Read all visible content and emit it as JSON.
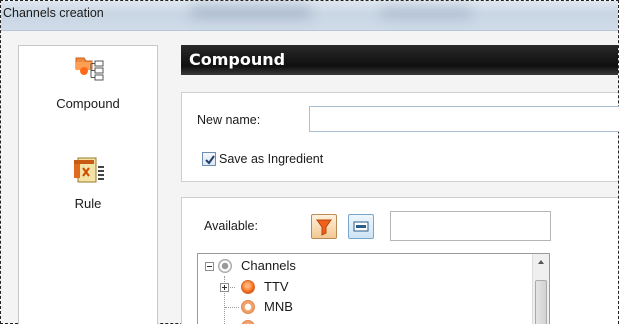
{
  "window": {
    "title": "Channels creation"
  },
  "nav": {
    "items": [
      {
        "label": "Compound",
        "icon": "compound-icon"
      },
      {
        "label": "Rule",
        "icon": "rule-icon"
      }
    ]
  },
  "header": {
    "title": "Compound"
  },
  "form": {
    "new_name_label": "New name:",
    "new_name_value": "",
    "save_as_ingredient_label": "Save as Ingredient",
    "save_as_ingredient_checked": true
  },
  "available": {
    "label": "Available:",
    "search_value": "",
    "filter_icon": "filter-icon",
    "view_icon": "list-view-icon"
  },
  "tree": {
    "root": "Channels",
    "children": [
      "TTV",
      "MNB"
    ]
  },
  "colors": {
    "header_bg": "#111111",
    "accent_orange": "#ff7a2a",
    "titlebar": "#cfdbe8"
  }
}
